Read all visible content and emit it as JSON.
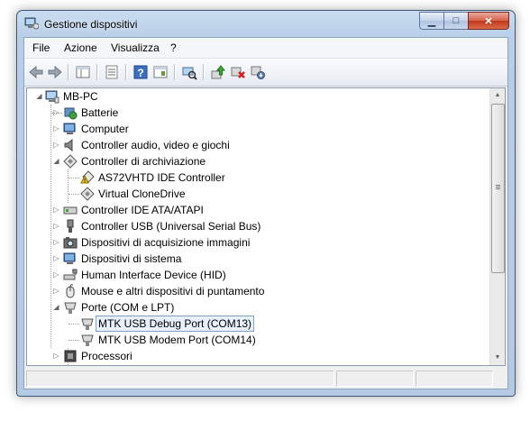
{
  "window": {
    "title": "Gestione dispositivi"
  },
  "caption": {
    "minimize": "▁",
    "maximize": "□",
    "close": "✕"
  },
  "menu": [
    "File",
    "Azione",
    "Visualizza",
    "?"
  ],
  "toolbar": [
    "back-icon",
    "forward-icon",
    "show-hide-tree-icon",
    "properties-icon",
    "help-icon",
    "console-tree-icon",
    "scan-hardware-icon",
    "update-driver-icon",
    "uninstall-icon",
    "disable-icon"
  ],
  "tree": [
    {
      "label": "MB-PC",
      "icon": "computer-root-icon",
      "expanded": true,
      "depth": 0
    },
    {
      "label": "Batterie",
      "icon": "battery-icon",
      "depth": 1
    },
    {
      "label": "Computer",
      "icon": "computer-icon",
      "depth": 1
    },
    {
      "label": "Controller audio, video e giochi",
      "icon": "speaker-icon",
      "depth": 1
    },
    {
      "label": "Controller di archiviazione",
      "icon": "storage-controller-icon",
      "expanded": true,
      "depth": 1
    },
    {
      "label": "AS72VHTD IDE Controller",
      "icon": "warning-storage-icon",
      "depth": 2
    },
    {
      "label": "Virtual CloneDrive",
      "icon": "storage-controller-icon",
      "depth": 2
    },
    {
      "label": "Controller IDE ATA/ATAPI",
      "icon": "ide-icon",
      "depth": 1
    },
    {
      "label": "Controller USB (Universal Serial Bus)",
      "icon": "usb-icon",
      "depth": 1
    },
    {
      "label": "Dispositivi di acquisizione immagini",
      "icon": "camera-icon",
      "depth": 1
    },
    {
      "label": "Dispositivi di sistema",
      "icon": "system-device-icon",
      "depth": 1
    },
    {
      "label": "Human Interface Device (HID)",
      "icon": "hid-icon",
      "depth": 1
    },
    {
      "label": "Mouse e altri dispositivi di puntamento",
      "icon": "mouse-icon",
      "depth": 1
    },
    {
      "label": "Porte (COM e LPT)",
      "icon": "port-icon",
      "expanded": true,
      "depth": 1
    },
    {
      "label": "MTK USB Debug Port (COM13)",
      "icon": "port-icon",
      "depth": 2,
      "selected": true
    },
    {
      "label": "MTK USB Modem Port (COM14)",
      "icon": "port-icon",
      "depth": 2
    },
    {
      "label": "Processori",
      "icon": "processor-icon",
      "depth": 1
    }
  ],
  "colors": {
    "accent": "#3f5875",
    "selection": "#e8f0fb",
    "close": "#c2381c"
  }
}
